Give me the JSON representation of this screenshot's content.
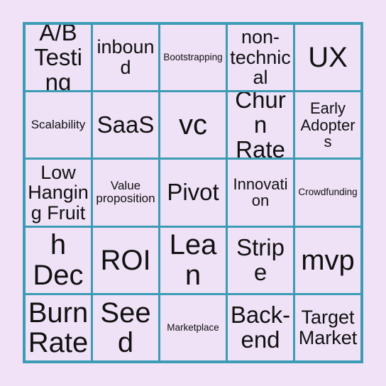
{
  "card": {
    "type": "bingo-card",
    "rows": 5,
    "columns": 5,
    "background_color": "#f2e2f7",
    "cell_fill_color": "#efe1f6",
    "grid_line_color": "#3c9cb5",
    "text_color": "#111111",
    "cells": [
      {
        "label": "A/B Testing",
        "size": "lg"
      },
      {
        "label": "inbound",
        "size": "md"
      },
      {
        "label": "Bootstrapping",
        "size": "xxs"
      },
      {
        "label": "non-technical",
        "size": "md"
      },
      {
        "label": "UX",
        "size": "xl"
      },
      {
        "label": "Scalability",
        "size": "xs"
      },
      {
        "label": "SaaS",
        "size": "lg"
      },
      {
        "label": "vc",
        "size": "xl"
      },
      {
        "label": "Churn Rate",
        "size": "lg"
      },
      {
        "label": "Early Adopters",
        "size": "sm"
      },
      {
        "label": "Low Hanging Fruit",
        "size": "md"
      },
      {
        "label": "Value proposition",
        "size": "xs"
      },
      {
        "label": "Pivot",
        "size": "lg"
      },
      {
        "label": "Innovation",
        "size": "sm"
      },
      {
        "label": "Crowdfunding",
        "size": "xxs"
      },
      {
        "label": "Pitch Deck",
        "size": "xl"
      },
      {
        "label": "ROI",
        "size": "xl"
      },
      {
        "label": "Lean",
        "size": "xl"
      },
      {
        "label": "Stripe",
        "size": "lg"
      },
      {
        "label": "mvp",
        "size": "xl"
      },
      {
        "label": "Burn Rate",
        "size": "xl"
      },
      {
        "label": "Seed",
        "size": "xl"
      },
      {
        "label": "Marketplace",
        "size": "xxs"
      },
      {
        "label": "Back-end",
        "size": "lg"
      },
      {
        "label": "Target Market",
        "size": "md"
      }
    ]
  }
}
